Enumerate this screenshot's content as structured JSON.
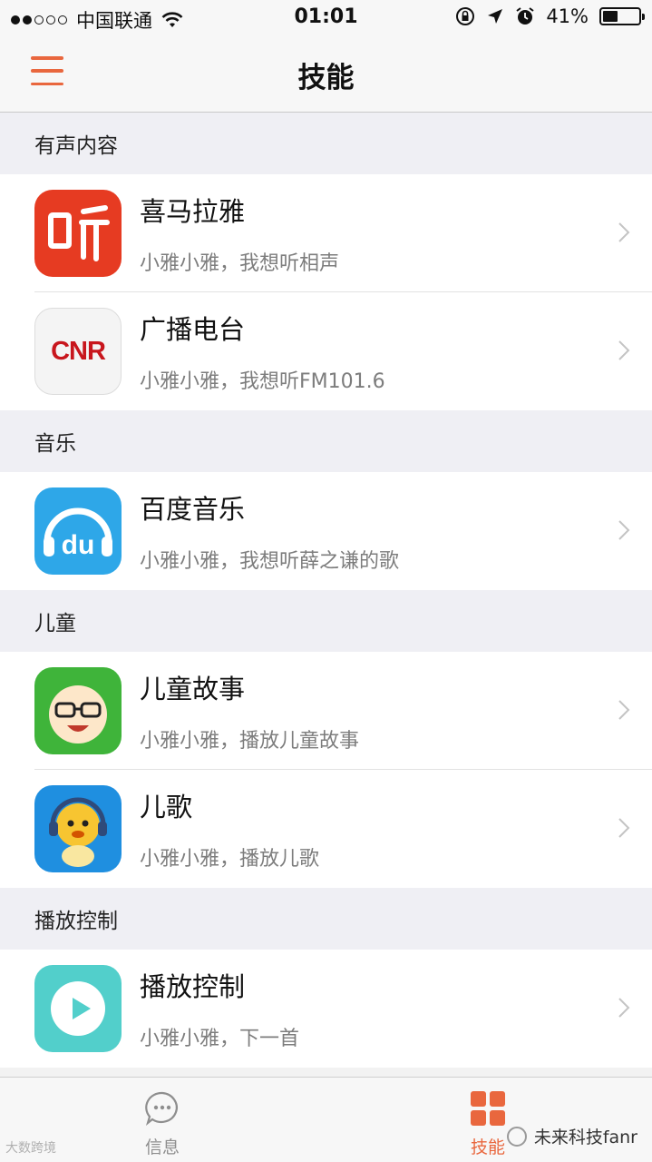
{
  "status_bar": {
    "carrier": "中国联通",
    "time": "01:01",
    "battery": "41%",
    "battery_level": 0.41,
    "signal_strength": 2
  },
  "nav": {
    "title": "技能",
    "menu_icon": "hamburger-menu-icon",
    "accent_color": "#e9673e"
  },
  "sections": [
    {
      "header": "有声内容",
      "items": [
        {
          "title": "喜马拉雅",
          "subtitle": "小雅小雅，我想听相声",
          "icon": "ximalaya-icon"
        },
        {
          "title": "广播电台",
          "subtitle": "小雅小雅，我想听FM101.6",
          "icon": "cnr-icon"
        }
      ]
    },
    {
      "header": "音乐",
      "items": [
        {
          "title": "百度音乐",
          "subtitle": "小雅小雅，我想听薛之谦的歌",
          "icon": "baidu-music-icon"
        }
      ]
    },
    {
      "header": "儿童",
      "items": [
        {
          "title": "儿童故事",
          "subtitle": "小雅小雅，播放儿童故事",
          "icon": "kids-story-icon"
        },
        {
          "title": "儿歌",
          "subtitle": "小雅小雅，播放儿歌",
          "icon": "kids-song-icon"
        }
      ]
    },
    {
      "header": "播放控制",
      "items": [
        {
          "title": "播放控制",
          "subtitle": "小雅小雅，下一首",
          "icon": "play-control-icon"
        }
      ]
    }
  ],
  "icons": {
    "ximalaya_text": "听",
    "cnr_text": "CNR",
    "baidu_text": "du"
  },
  "tab_bar": {
    "messages_label": "信息",
    "skills_label": "技能"
  },
  "watermarks": {
    "left": "大数跨境",
    "right": "未来科技fanr"
  }
}
